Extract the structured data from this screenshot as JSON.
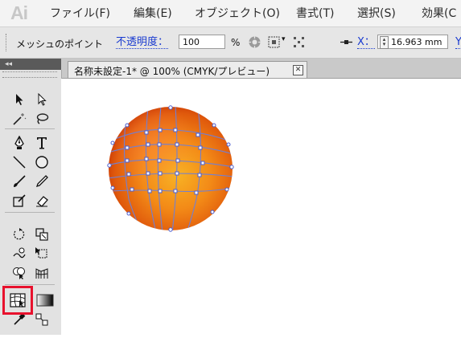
{
  "app": {
    "logo": "Ai"
  },
  "menu": {
    "file": "ファイル(F)",
    "edit": "編集(E)",
    "object": "オブジェクト(O)",
    "type": "書式(T)",
    "select": "選択(S)",
    "effect": "効果(C"
  },
  "control_panel": {
    "selection_label": "メッシュのポイント",
    "opacity_label": "不透明度：",
    "opacity_value": "100",
    "percent": "%",
    "x_label": "X：",
    "x_value": "16.963 mm",
    "next_label": "Y"
  },
  "panel_strip": {
    "collapse": "◂◂"
  },
  "document": {
    "tab_title": "名称未設定-1* @ 100% (CMYK/プレビュー)",
    "close_glyph": "✕"
  },
  "tools": [
    "selection-tool-icon",
    "direct-selection-tool-icon",
    "magic-wand-tool-icon",
    "lasso-tool-icon",
    "pen-tool-icon",
    "type-tool-icon",
    "line-segment-tool-icon",
    "ellipse-tool-icon",
    "paintbrush-tool-icon",
    "pencil-tool-icon",
    "blob-brush-tool-icon",
    "eraser-tool-icon",
    "rotate-tool-icon",
    "scale-tool-icon",
    "warp-tool-icon",
    "free-transform-tool-icon",
    "shape-builder-tool-icon",
    "perspective-grid-tool-icon",
    "mesh-tool-icon",
    "gradient-tool-icon",
    "eyedropper-tool-icon",
    "blend-tool-icon"
  ],
  "active_tool": "mesh-tool-icon",
  "colors": {
    "highlight_box": "#e8112d",
    "sphere_dark": "#cc2f00",
    "sphere_mid": "#f06a10",
    "sphere_light": "#f8b324",
    "mesh_lines": "#6f7fd6"
  }
}
